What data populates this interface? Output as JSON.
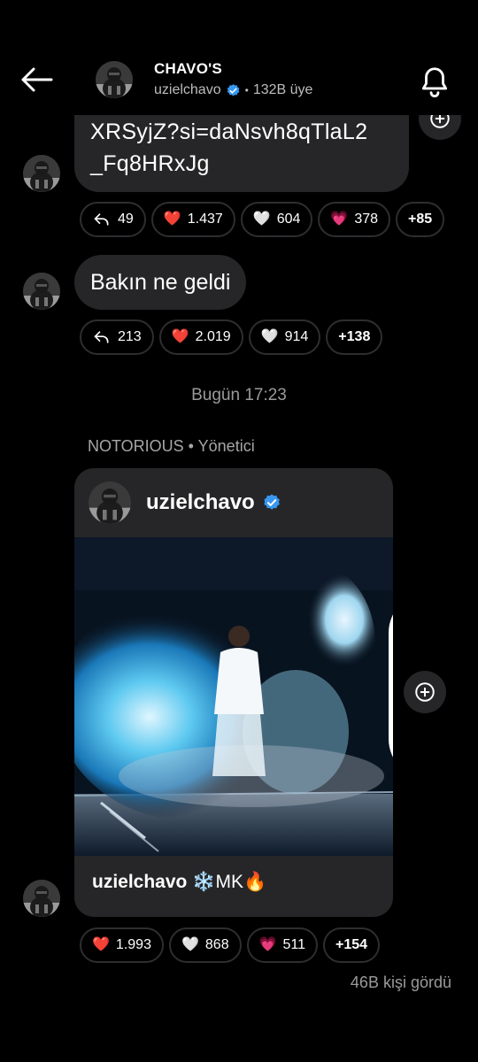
{
  "header": {
    "title": "CHAVO'S",
    "username": "uzielchavo",
    "separator": "•",
    "members": "132B üye"
  },
  "messages": {
    "link_message": {
      "text": "XRSyjZ?si=daNsvh8qTlaL2\n_Fq8HRxJg"
    },
    "link_reactions": [
      {
        "icon": "reply-icon",
        "count": "49"
      },
      {
        "icon": "red-heart",
        "emoji": "❤️",
        "count": "1.437"
      },
      {
        "icon": "white-heart",
        "emoji": "🤍",
        "count": "604"
      },
      {
        "icon": "pink-heart",
        "emoji": "💗",
        "count": "378"
      },
      {
        "label": "+85"
      }
    ],
    "text_message": {
      "text": "Bakın ne geldi"
    },
    "text_reactions": [
      {
        "icon": "reply-icon",
        "count": "213"
      },
      {
        "icon": "red-heart",
        "emoji": "❤️",
        "count": "2.019"
      },
      {
        "icon": "white-heart",
        "emoji": "🤍",
        "count": "914"
      },
      {
        "label": "+138"
      }
    ],
    "timestamp": "Bugün 17:23",
    "sender": "NOTORIOUS • Yönetici",
    "post": {
      "username": "uzielchavo",
      "caption_user": "uzielchavo",
      "caption_text": "❄️MK🔥"
    },
    "post_reactions": [
      {
        "icon": "red-heart",
        "emoji": "❤️",
        "count": "1.993"
      },
      {
        "icon": "white-heart",
        "emoji": "🤍",
        "count": "868"
      },
      {
        "icon": "pink-heart",
        "emoji": "💗",
        "count": "511"
      },
      {
        "label": "+154"
      }
    ],
    "seen": "46B kişi gördü"
  },
  "colors": {
    "background": "#000000",
    "bubble": "#262628",
    "verified": "#3897f0",
    "muted": "#9a9a9a"
  }
}
